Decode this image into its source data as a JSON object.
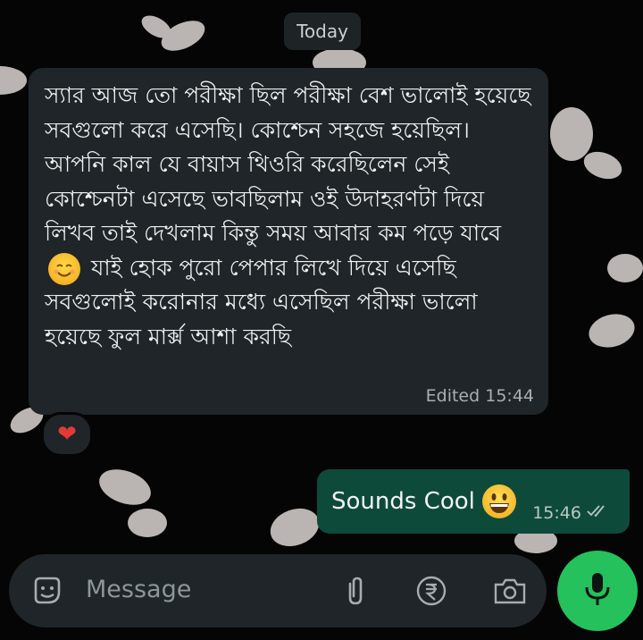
{
  "date_chip": "Today",
  "incoming": {
    "text": "স্যার আজ তো পরীক্ষা ছিল পরীক্ষা বেশ ভালোই হয়েছে সবগুলো করে এসেছি। কোশ্চেন সহজে হয়েছিল। আপনি কাল যে বায়াস থিওরি করেছিলেন সেই কোশ্চেনটা এসেছে ভাবছিলাম ওই উদাহরণটা দিয়ে লিখব তাই দেখলাম কিন্তু সময় আবার কম পড়ে যাবে",
    "text_after_emoji": "যাই হোক পুরো পেপার লিখে দিয়ে এসেছি সবগুলোই করোনার মধ্যে এসেছিল পরীক্ষা ভালো হয়েছে ফুল মার্ক্স আশা করছি",
    "edited_label": "Edited",
    "time": "15:44",
    "reaction": "heart"
  },
  "outgoing": {
    "text": "Sounds Cool",
    "time": "15:46",
    "status": "read"
  },
  "composer": {
    "placeholder": "Message"
  },
  "icons": [
    "sticker-icon",
    "attach-icon",
    "rupee-payment-icon",
    "camera-icon",
    "mic-icon"
  ],
  "colors": {
    "incoming_bubble": "#1f2528",
    "outgoing_bubble": "#0e4a3a",
    "mic_button": "#25c15c"
  }
}
